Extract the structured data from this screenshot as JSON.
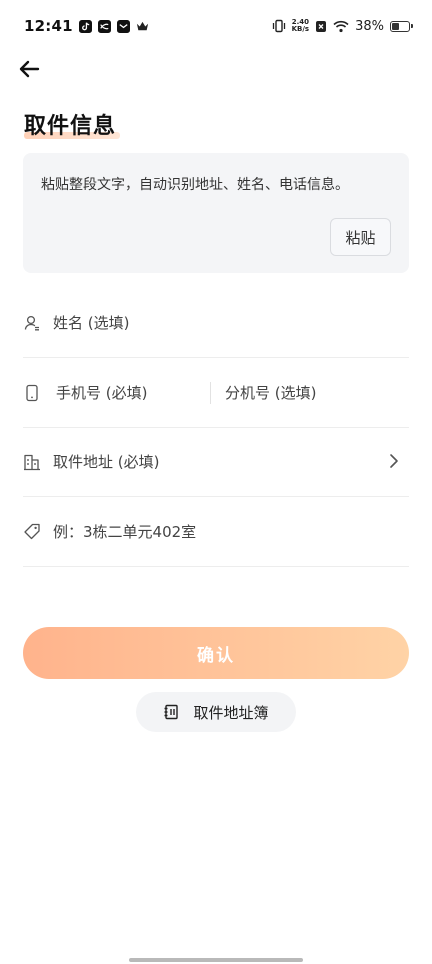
{
  "status_bar": {
    "time": "12:41",
    "net_speed_value": "2.40",
    "net_speed_unit": "KB/s",
    "battery_percent": "38%",
    "battery_level": 0.38
  },
  "page": {
    "title": "取件信息"
  },
  "paste_box": {
    "hint": "粘贴整段文字，自动识别地址、姓名、电话信息。",
    "paste_label": "粘贴"
  },
  "form": {
    "name_placeholder": "姓名 (选填)",
    "phone_placeholder": "手机号 (必填)",
    "ext_placeholder": "分机号 (选填)",
    "address_placeholder": "取件地址 (必填)",
    "detail_placeholder": "例：3栋二单元402室"
  },
  "actions": {
    "confirm_label": "确认",
    "address_book_label": "取件地址簿"
  },
  "colors": {
    "accent_start": "#ffb38c",
    "accent_end": "#ffd3a6"
  }
}
